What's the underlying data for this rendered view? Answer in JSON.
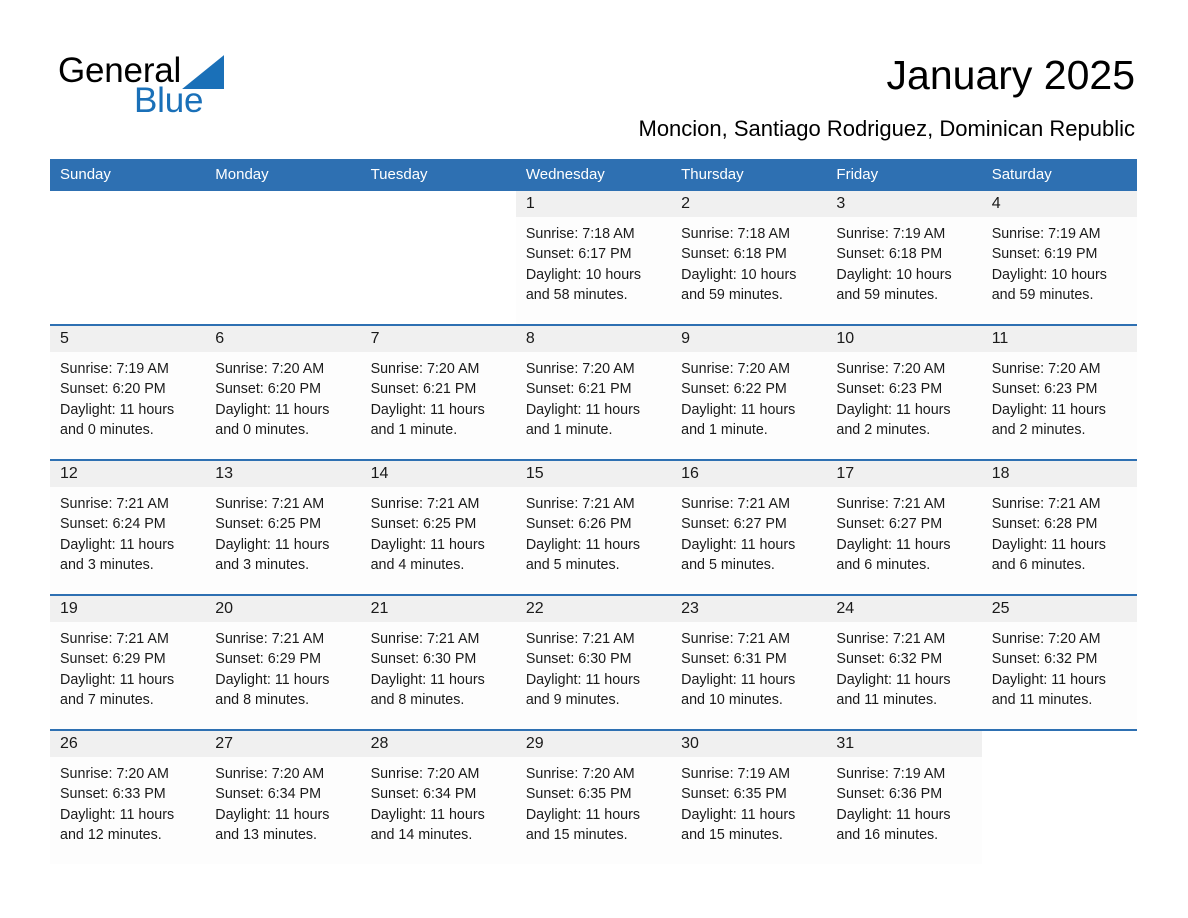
{
  "brand": {
    "word1": "General",
    "word2": "Blue",
    "accent_color": "#1a70b8"
  },
  "header": {
    "title": "January 2025",
    "subtitle": "Moncion, Santiago Rodriguez, Dominican Republic"
  },
  "theme": {
    "header_bg": "#2e70b2",
    "header_text": "#ffffff",
    "daynum_bg": "#f0f0f0",
    "row_rule": "#2e70b2"
  },
  "calendar": {
    "weekdays": [
      "Sunday",
      "Monday",
      "Tuesday",
      "Wednesday",
      "Thursday",
      "Friday",
      "Saturday"
    ],
    "weeks": [
      [
        {
          "day": "",
          "info": ""
        },
        {
          "day": "",
          "info": ""
        },
        {
          "day": "",
          "info": ""
        },
        {
          "day": "1",
          "info": "Sunrise: 7:18 AM\nSunset: 6:17 PM\nDaylight: 10 hours\nand 58 minutes."
        },
        {
          "day": "2",
          "info": "Sunrise: 7:18 AM\nSunset: 6:18 PM\nDaylight: 10 hours\nand 59 minutes."
        },
        {
          "day": "3",
          "info": "Sunrise: 7:19 AM\nSunset: 6:18 PM\nDaylight: 10 hours\nand 59 minutes."
        },
        {
          "day": "4",
          "info": "Sunrise: 7:19 AM\nSunset: 6:19 PM\nDaylight: 10 hours\nand 59 minutes."
        }
      ],
      [
        {
          "day": "5",
          "info": "Sunrise: 7:19 AM\nSunset: 6:20 PM\nDaylight: 11 hours\nand 0 minutes."
        },
        {
          "day": "6",
          "info": "Sunrise: 7:20 AM\nSunset: 6:20 PM\nDaylight: 11 hours\nand 0 minutes."
        },
        {
          "day": "7",
          "info": "Sunrise: 7:20 AM\nSunset: 6:21 PM\nDaylight: 11 hours\nand 1 minute."
        },
        {
          "day": "8",
          "info": "Sunrise: 7:20 AM\nSunset: 6:21 PM\nDaylight: 11 hours\nand 1 minute."
        },
        {
          "day": "9",
          "info": "Sunrise: 7:20 AM\nSunset: 6:22 PM\nDaylight: 11 hours\nand 1 minute."
        },
        {
          "day": "10",
          "info": "Sunrise: 7:20 AM\nSunset: 6:23 PM\nDaylight: 11 hours\nand 2 minutes."
        },
        {
          "day": "11",
          "info": "Sunrise: 7:20 AM\nSunset: 6:23 PM\nDaylight: 11 hours\nand 2 minutes."
        }
      ],
      [
        {
          "day": "12",
          "info": "Sunrise: 7:21 AM\nSunset: 6:24 PM\nDaylight: 11 hours\nand 3 minutes."
        },
        {
          "day": "13",
          "info": "Sunrise: 7:21 AM\nSunset: 6:25 PM\nDaylight: 11 hours\nand 3 minutes."
        },
        {
          "day": "14",
          "info": "Sunrise: 7:21 AM\nSunset: 6:25 PM\nDaylight: 11 hours\nand 4 minutes."
        },
        {
          "day": "15",
          "info": "Sunrise: 7:21 AM\nSunset: 6:26 PM\nDaylight: 11 hours\nand 5 minutes."
        },
        {
          "day": "16",
          "info": "Sunrise: 7:21 AM\nSunset: 6:27 PM\nDaylight: 11 hours\nand 5 minutes."
        },
        {
          "day": "17",
          "info": "Sunrise: 7:21 AM\nSunset: 6:27 PM\nDaylight: 11 hours\nand 6 minutes."
        },
        {
          "day": "18",
          "info": "Sunrise: 7:21 AM\nSunset: 6:28 PM\nDaylight: 11 hours\nand 6 minutes."
        }
      ],
      [
        {
          "day": "19",
          "info": "Sunrise: 7:21 AM\nSunset: 6:29 PM\nDaylight: 11 hours\nand 7 minutes."
        },
        {
          "day": "20",
          "info": "Sunrise: 7:21 AM\nSunset: 6:29 PM\nDaylight: 11 hours\nand 8 minutes."
        },
        {
          "day": "21",
          "info": "Sunrise: 7:21 AM\nSunset: 6:30 PM\nDaylight: 11 hours\nand 8 minutes."
        },
        {
          "day": "22",
          "info": "Sunrise: 7:21 AM\nSunset: 6:30 PM\nDaylight: 11 hours\nand 9 minutes."
        },
        {
          "day": "23",
          "info": "Sunrise: 7:21 AM\nSunset: 6:31 PM\nDaylight: 11 hours\nand 10 minutes."
        },
        {
          "day": "24",
          "info": "Sunrise: 7:21 AM\nSunset: 6:32 PM\nDaylight: 11 hours\nand 11 minutes."
        },
        {
          "day": "25",
          "info": "Sunrise: 7:20 AM\nSunset: 6:32 PM\nDaylight: 11 hours\nand 11 minutes."
        }
      ],
      [
        {
          "day": "26",
          "info": "Sunrise: 7:20 AM\nSunset: 6:33 PM\nDaylight: 11 hours\nand 12 minutes."
        },
        {
          "day": "27",
          "info": "Sunrise: 7:20 AM\nSunset: 6:34 PM\nDaylight: 11 hours\nand 13 minutes."
        },
        {
          "day": "28",
          "info": "Sunrise: 7:20 AM\nSunset: 6:34 PM\nDaylight: 11 hours\nand 14 minutes."
        },
        {
          "day": "29",
          "info": "Sunrise: 7:20 AM\nSunset: 6:35 PM\nDaylight: 11 hours\nand 15 minutes."
        },
        {
          "day": "30",
          "info": "Sunrise: 7:19 AM\nSunset: 6:35 PM\nDaylight: 11 hours\nand 15 minutes."
        },
        {
          "day": "31",
          "info": "Sunrise: 7:19 AM\nSunset: 6:36 PM\nDaylight: 11 hours\nand 16 minutes."
        },
        {
          "day": "",
          "info": ""
        }
      ]
    ]
  }
}
